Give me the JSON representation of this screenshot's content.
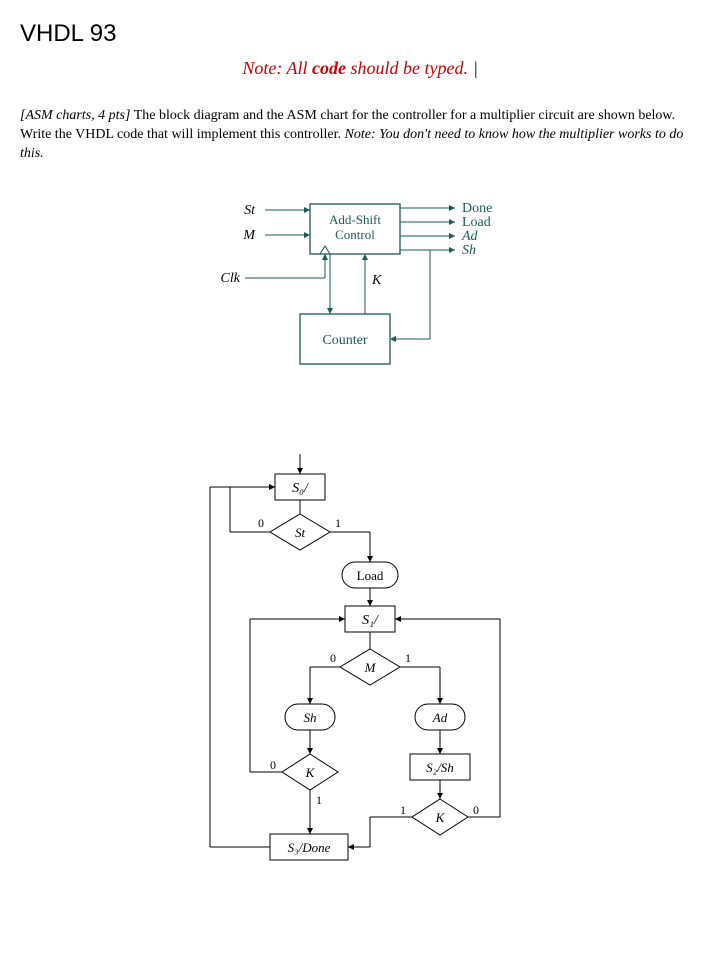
{
  "title": "VHDL 93",
  "note": {
    "prefix": "Note: All ",
    "code_word": "code",
    "suffix": " should be typed.",
    "cursor": "|"
  },
  "problem": {
    "lead": "[ASM charts, 4 pts]",
    "body": " The block diagram and the ASM chart for the controller for a multiplier circuit are shown below. Write the VHDL code that will implement this controller. ",
    "trail": "Note: You don't need to know how the multiplier works to do this."
  },
  "block": {
    "add_shift": "Add-Shift\nControl",
    "counter": "Counter",
    "in_st": "St",
    "in_m": "M",
    "in_clk": "Clk",
    "in_k": "K",
    "out_done": "Done",
    "out_load": "Load",
    "out_ad": "Ad",
    "out_sh": "Sh"
  },
  "asm": {
    "s0": "S₀/",
    "st": "St",
    "load": "Load",
    "s1": "S₁/",
    "m": "M",
    "sh": "Sh",
    "ad": "Ad",
    "k_left": "K",
    "s2": "S₂/Sh",
    "k_right": "K",
    "s3": "S₃/Done",
    "zero": "0",
    "one": "1"
  }
}
